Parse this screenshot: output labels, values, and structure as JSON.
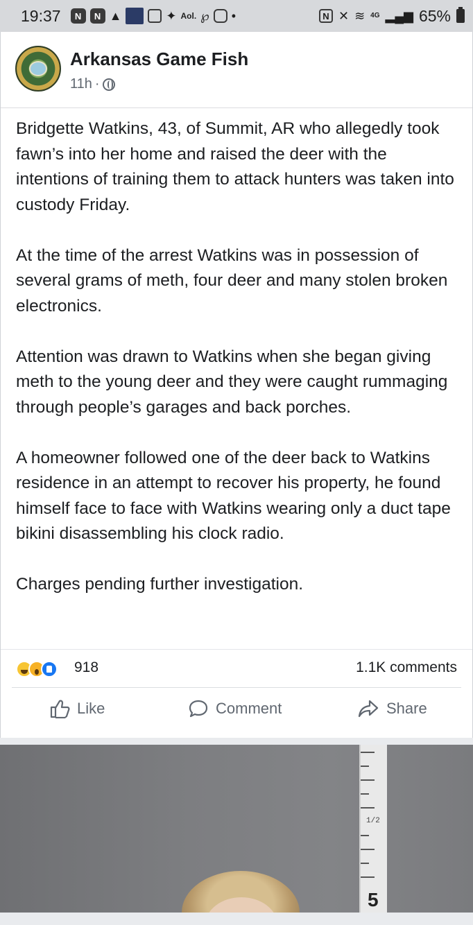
{
  "status_bar": {
    "time": "19:37",
    "battery": "65%",
    "icons": [
      "notification-box-icon",
      "notification-box-icon",
      "snapchat-icon",
      "news-alert-icon",
      "screenshot-icon",
      "twitter-icon",
      "aol-icon",
      "pinterest-icon",
      "instagram-icon",
      "dot-icon",
      "nfc-icon",
      "mute-icon",
      "wifi-icon",
      "4g-icon",
      "signal-icon",
      "battery-icon"
    ],
    "aol_label": "Aol."
  },
  "post": {
    "page_name": "Arkansas Game Fish",
    "time_ago": "11h",
    "meta_separator": "·",
    "paragraphs": [
      "Bridgette Watkins, 43, of Summit, AR who allegedly took fawn’s into her home and raised the deer with the intentions of training them to attack hunters was taken into custody Friday.",
      "At the time of the arrest Watkins was in possession of  several grams of meth, four deer and many stolen broken electronics.",
      "Attention was drawn to Watkins when she began giving meth to the young deer and they were caught rummaging through people’s garages and back porches.",
      "A homeowner followed one of the deer back to Watkins residence in an attempt to recover his property, he found himself face to face with Watkins wearing only a duct tape bikini disassembling his clock radio.",
      "Charges pending further investigation."
    ],
    "reaction_count": "918",
    "comments_count": "1.1K comments",
    "actions": {
      "like": "Like",
      "comment": "Comment",
      "share": "Share"
    }
  },
  "photo": {
    "height_chart_mark": "1/2",
    "height_chart_number": "5"
  },
  "colors": {
    "text": "#1c1e21",
    "secondary": "#606770",
    "like_blue": "#1877f2",
    "status_bar_bg": "#d7d9dc"
  }
}
